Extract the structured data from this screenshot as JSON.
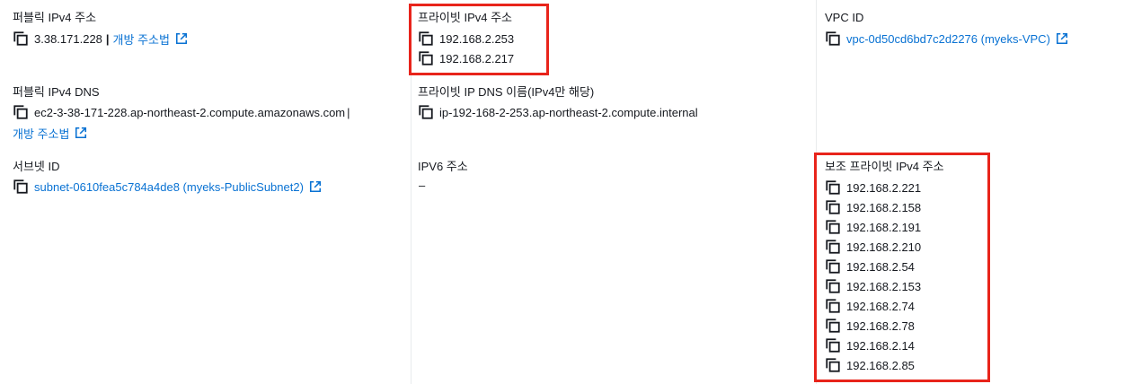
{
  "public_ipv4": {
    "label": "퍼블릭 IPv4 주소",
    "value": "3.38.171.228",
    "separator": "|",
    "open_link": "개방 주소법"
  },
  "private_ipv4": {
    "label": "프라이빗 IPv4 주소",
    "values": [
      "192.168.2.253",
      "192.168.2.217"
    ]
  },
  "vpc": {
    "label": "VPC ID",
    "value": "vpc-0d50cd6bd7c2d2276 (myeks-VPC)"
  },
  "public_dns": {
    "label": "퍼블릭 IPv4 DNS",
    "value": "ec2-3-38-171-228.ap-northeast-2.compute.amazonaws.com",
    "separator": "|",
    "open_link": "개방 주소법"
  },
  "private_dns": {
    "label": "프라이빗 IP DNS 이름(IPv4만 해당)",
    "value": "ip-192-168-2-253.ap-northeast-2.compute.internal"
  },
  "subnet": {
    "label": "서브넷 ID",
    "value": "subnet-0610fea5c784a4de8 (myeks-PublicSubnet2)"
  },
  "ipv6": {
    "label": "IPV6 주소",
    "value": "–"
  },
  "secondary_ipv4": {
    "label": "보조 프라이빗 IPv4 주소",
    "values": [
      "192.168.2.221",
      "192.168.2.158",
      "192.168.2.191",
      "192.168.2.210",
      "192.168.2.54",
      "192.168.2.153",
      "192.168.2.74",
      "192.168.2.78",
      "192.168.2.14",
      "192.168.2.85"
    ]
  },
  "colors": {
    "link": "#0972d3",
    "highlight": "#e8241b",
    "text": "#16191f",
    "divider": "#e9ebed"
  },
  "icons": {
    "copy": "copy-icon",
    "external": "external-link-icon"
  }
}
